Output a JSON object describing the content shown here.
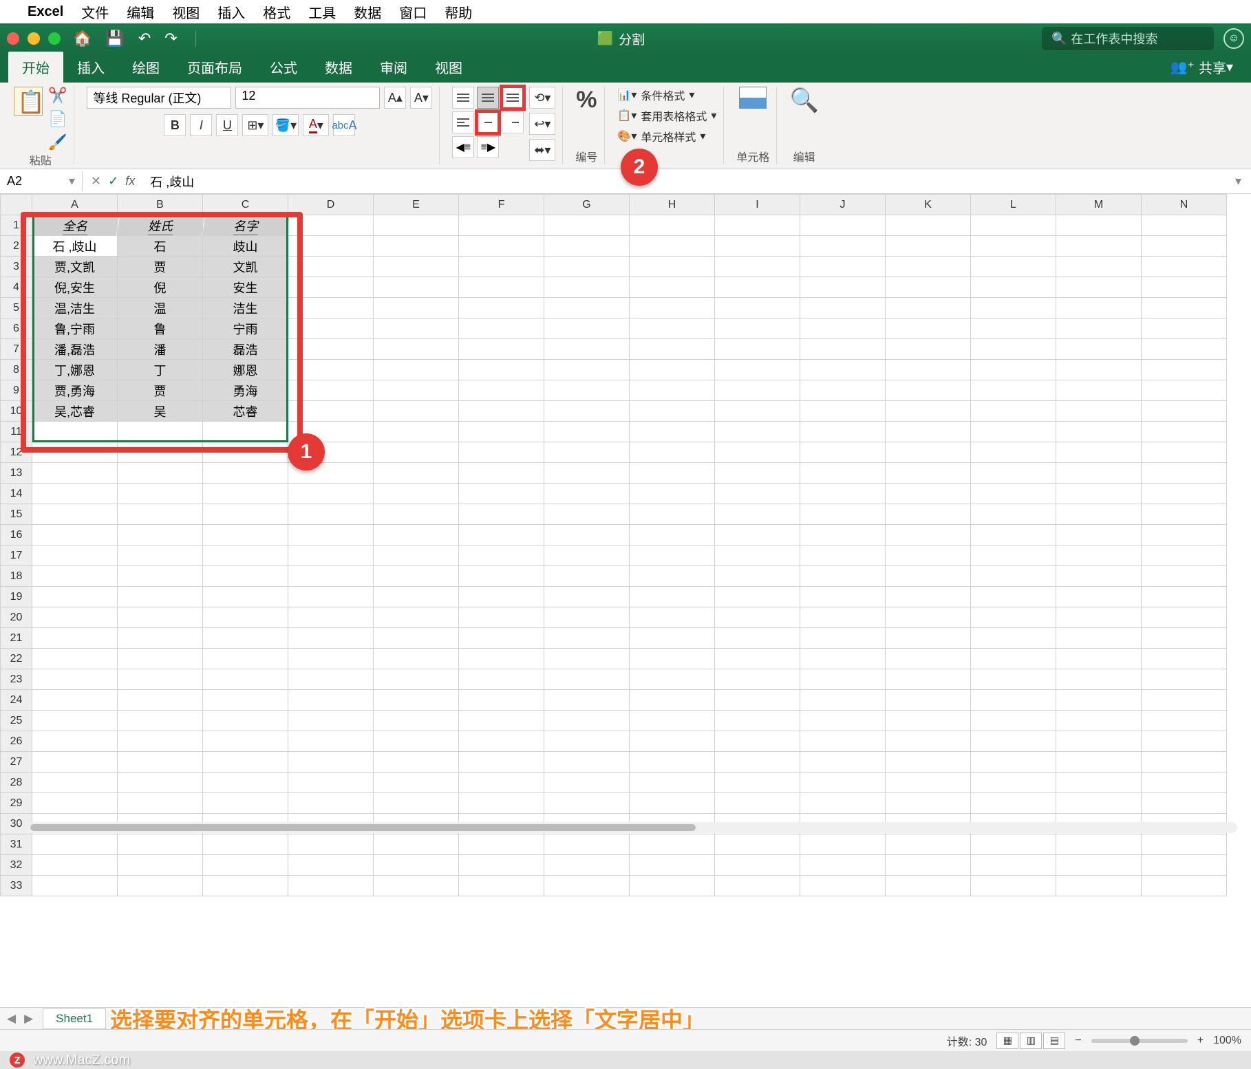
{
  "mac_menu": {
    "app": "Excel",
    "items": [
      "文件",
      "编辑",
      "视图",
      "插入",
      "格式",
      "工具",
      "数据",
      "窗口",
      "帮助"
    ]
  },
  "titlebar": {
    "doc_title": "分割",
    "search_placeholder": "在工作表中搜索"
  },
  "ribbon_tabs": [
    "开始",
    "插入",
    "绘图",
    "页面布局",
    "公式",
    "数据",
    "审阅",
    "视图"
  ],
  "share": "共享",
  "ribbon": {
    "paste": "粘贴",
    "font_name": "等线 Regular (正文)",
    "font_size": "12",
    "number": "编号",
    "styles": {
      "conditional": "条件格式",
      "table": "套用表格格式",
      "cell": "单元格样式"
    },
    "cells_label": "单元格",
    "edit_label": "编辑"
  },
  "formula": {
    "name_box": "A2",
    "content": "石 ,歧山"
  },
  "columns": [
    "A",
    "B",
    "C",
    "D",
    "E",
    "F",
    "G",
    "H",
    "I",
    "J",
    "K",
    "L",
    "M",
    "N"
  ],
  "headers": [
    "全名",
    "姓氏",
    "名字"
  ],
  "rows": [
    [
      "石 ,歧山",
      "石",
      "歧山"
    ],
    [
      "贾,文凯",
      "贾",
      "文凯"
    ],
    [
      "倪,安生",
      "倪",
      "安生"
    ],
    [
      "温,洁生",
      "温",
      "洁生"
    ],
    [
      "鲁,宁雨",
      "鲁",
      "宁雨"
    ],
    [
      "潘,磊浩",
      "潘",
      "磊浩"
    ],
    [
      "丁,娜恩",
      "丁",
      "娜恩"
    ],
    [
      "贾,勇海",
      "贾",
      "勇海"
    ],
    [
      "吴,芯睿",
      "吴",
      "芯睿"
    ]
  ],
  "row_count": 33,
  "sheet": {
    "name": "Sheet1"
  },
  "status": {
    "count_label": "计数:",
    "count": "30",
    "zoom": "100%"
  },
  "instruction_text": "选择要对齐的单元格，在「开始」选项卡上选择「文字居中」",
  "watermark": "www.MacZ.com",
  "badge1": "1",
  "badge2": "2"
}
